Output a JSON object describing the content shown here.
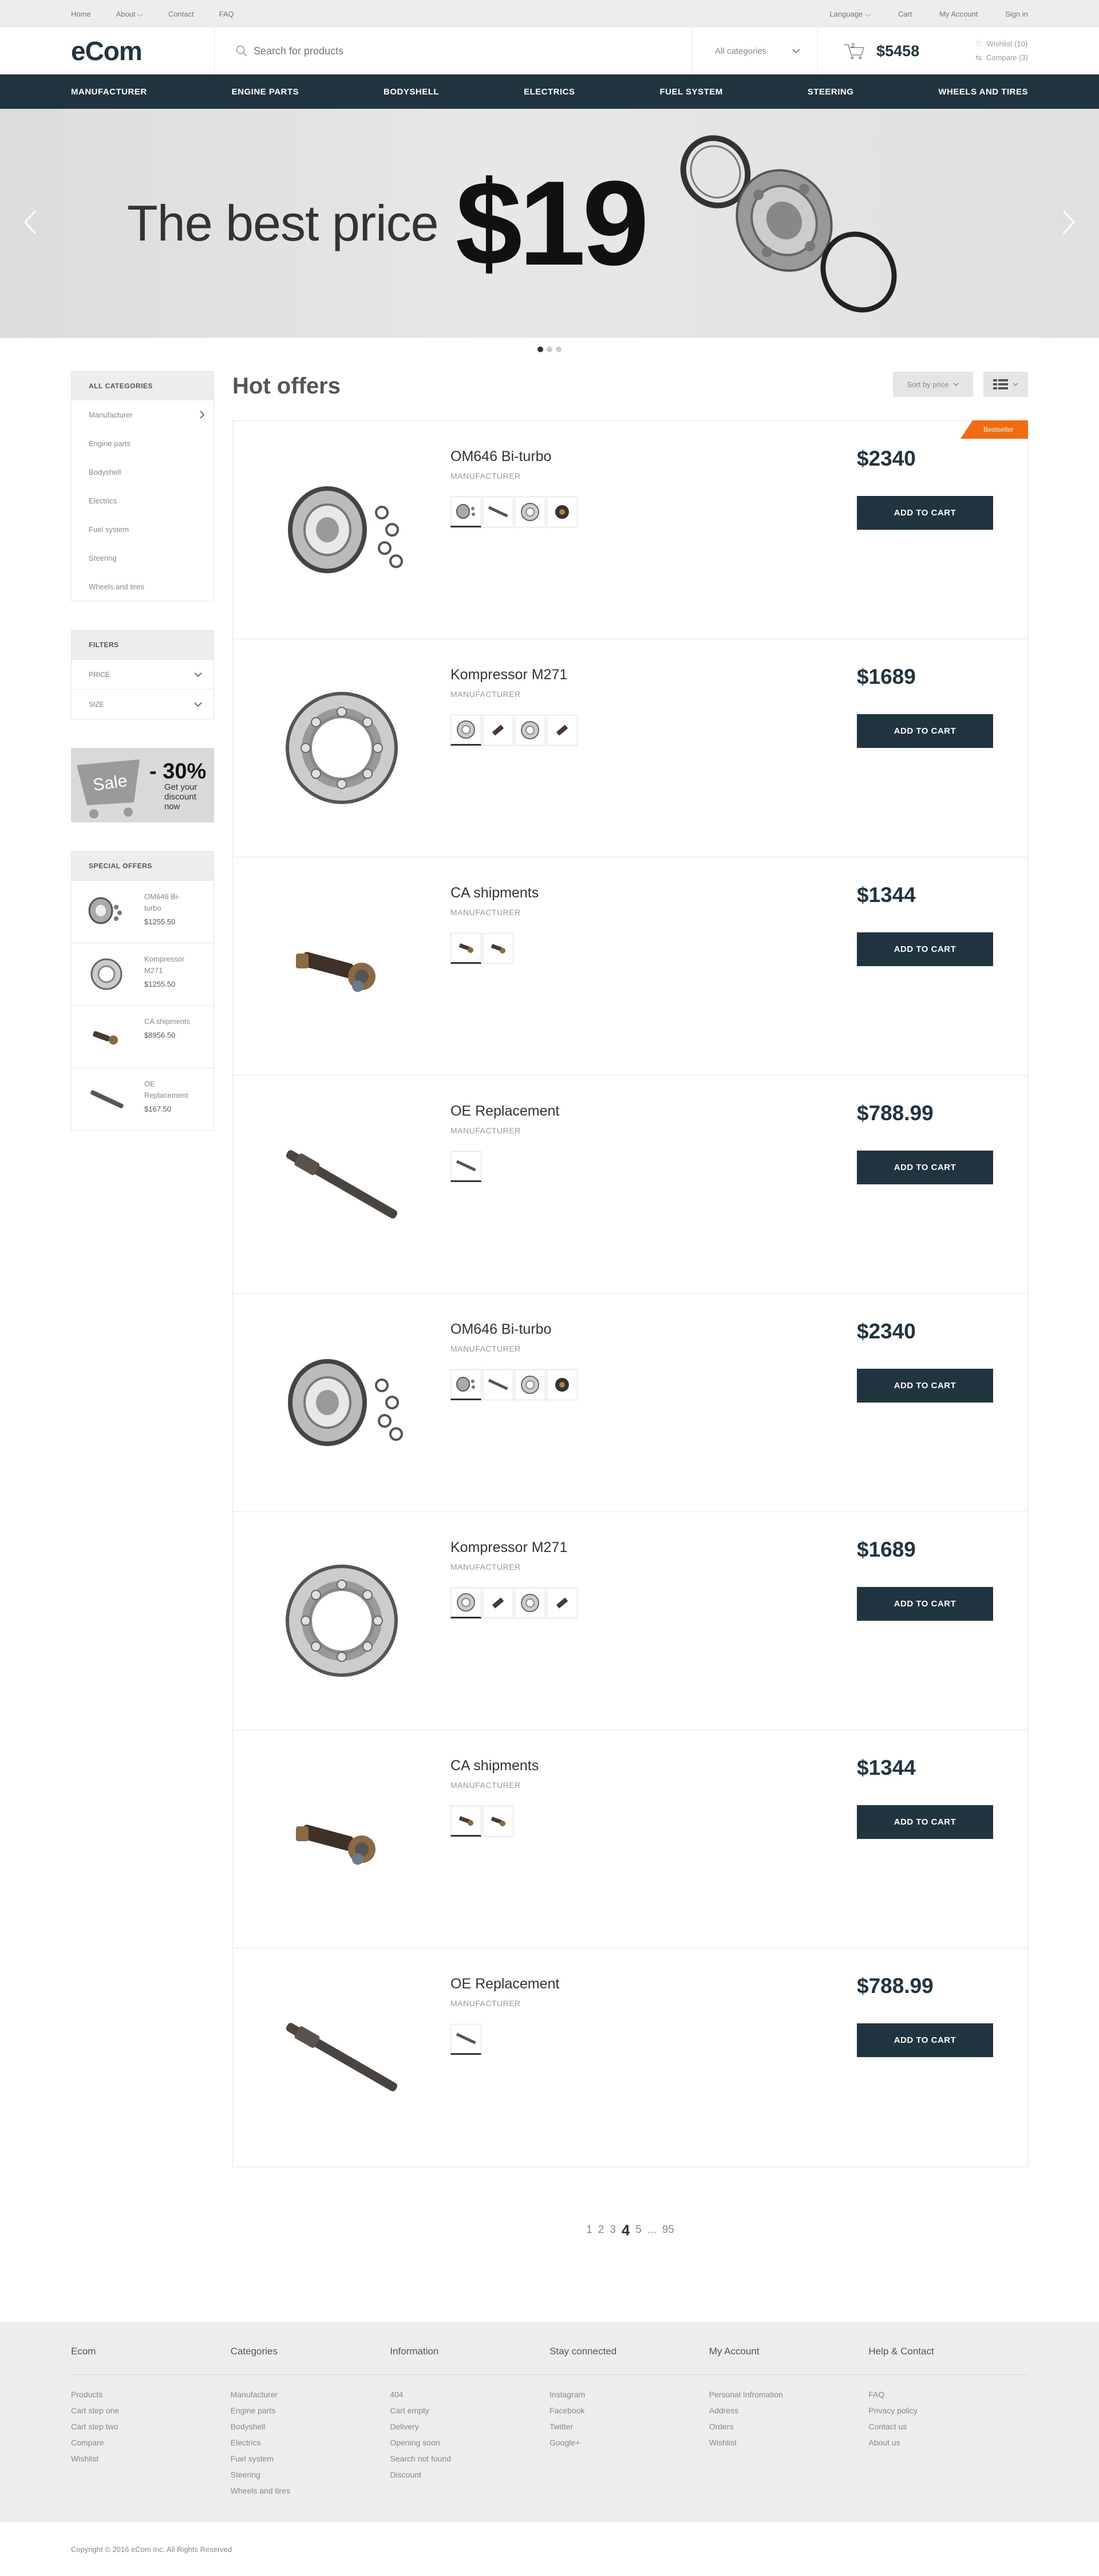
{
  "topbar": {
    "left": [
      "Home",
      "About",
      "Contact",
      "FAQ"
    ],
    "right": [
      "Language",
      "Cart",
      "My Account",
      "Sign in"
    ]
  },
  "header": {
    "logo": "eCom",
    "search_placeholder": "Search for products",
    "category_select": "All categories",
    "cart_count": "2",
    "cart_total": "$5458",
    "wishlist": "Wishlist (10)",
    "compare": "Compare (3)"
  },
  "nav": [
    "MANUFACTURER",
    "ENGINE PARTS",
    "BODYSHELL",
    "ELECTRICS",
    "FUEL SYSTEM",
    "STEERING",
    "WHEELS AND TIRES"
  ],
  "banner": {
    "text": "The best price",
    "price": "$19"
  },
  "sidebar": {
    "categories_title": "ALL CATEGORIES",
    "categories": [
      "Manufacturer",
      "Engine parts",
      "Bodyshell",
      "Electrics",
      "Fuel system",
      "Steering",
      "Wheels and tires"
    ],
    "filters_title": "FILTERS",
    "filters": [
      "PRICE",
      "SIZE"
    ],
    "sale": {
      "badge": "Sale",
      "percent": "- 30%",
      "line1": "Get your",
      "line2": "discount",
      "line3": "now"
    },
    "special_title": "SPECIAL OFFERS",
    "special": [
      {
        "name1": "OM646 Bi-",
        "name2": "turbo",
        "price": "$1255.50"
      },
      {
        "name1": "Kompressor",
        "name2": "M271",
        "price": "$1255.50"
      },
      {
        "name1": "CA shipments",
        "name2": "",
        "price": "$8956.50"
      },
      {
        "name1": "OE",
        "name2": "Replacement",
        "price": "$167.50"
      }
    ]
  },
  "content": {
    "title": "Hot offers",
    "sort": "Sort by price",
    "badge": "Bestseller",
    "manufacturer": "MANUFACTURER",
    "add_to_cart": "ADD TO CART",
    "products": [
      {
        "name": "OM646 Bi-turbo",
        "price": "$2340"
      },
      {
        "name": "Kompressor M271",
        "price": "$1689"
      },
      {
        "name": "CA shipments",
        "price": "$1344"
      },
      {
        "name": "OE Replacement",
        "price": "$788.99"
      },
      {
        "name": "OM646 Bi-turbo",
        "price": "$2340"
      },
      {
        "name": "Kompressor M271",
        "price": "$1689"
      },
      {
        "name": "CA shipments",
        "price": "$1344"
      },
      {
        "name": "OE Replacement",
        "price": "$788.99"
      }
    ]
  },
  "pagination": {
    "p1": "1",
    "p2": "2",
    "p3": "3",
    "p4": "4",
    "p5": "5",
    "ellipsis": "...",
    "last": "95"
  },
  "footer": {
    "cols": [
      {
        "title": "Ecom",
        "links": [
          "Products",
          "Cart step one",
          "Cart step two",
          "Compare",
          "Wishlist"
        ]
      },
      {
        "title": "Categories",
        "links": [
          "Manufacturer",
          "Engine parts",
          "Bodyshell",
          "Electrics",
          "Fuel system",
          "Steering",
          "Wheels and tires"
        ]
      },
      {
        "title": "Information",
        "links": [
          "404",
          "Cart empty",
          "Delivery",
          "Opening soon",
          "Search not found",
          "Discount"
        ]
      },
      {
        "title": "Stay connected",
        "links": [
          "Instagram",
          "Facebook",
          "Twitter",
          "Google+"
        ]
      },
      {
        "title": "My Account",
        "links": [
          "Personal Infromation",
          "Address",
          "Orders",
          "Wishlist"
        ]
      },
      {
        "title": "Help & Contact",
        "links": [
          "FAQ",
          "Privacy policy",
          "Contact us",
          "About us"
        ]
      }
    ],
    "copyright": "Copyright © 2016 eCom Inc. All Rights Reserved"
  },
  "colors": {
    "accent": "#203540",
    "badge": "#f26a12",
    "panel": "#eeedeb"
  }
}
